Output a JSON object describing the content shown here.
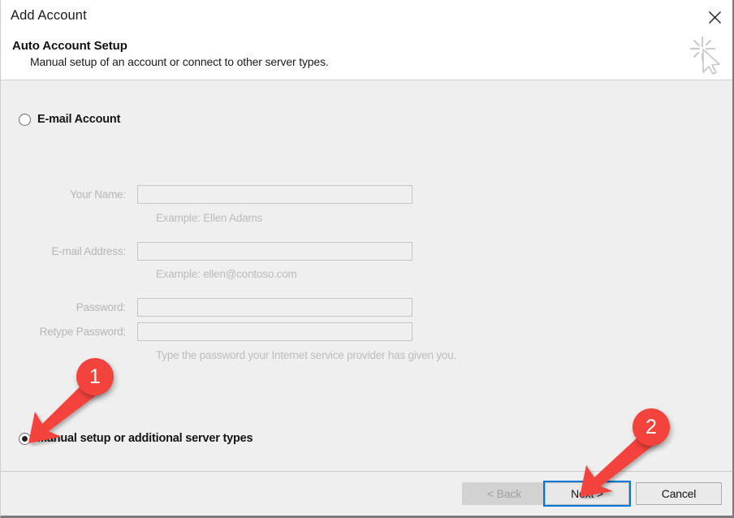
{
  "window": {
    "title": "Add Account",
    "close_icon": "close-icon",
    "header_icon": "cursor-sparkle-icon"
  },
  "header": {
    "heading": "Auto Account Setup",
    "subtext": "Manual setup of an account or connect to other server types."
  },
  "options": {
    "email_account": {
      "label": "E-mail Account",
      "selected": false
    },
    "manual_setup": {
      "label": "Manual setup or additional server types",
      "selected": true
    }
  },
  "form": {
    "enabled": false,
    "fields": [
      {
        "name": "your-name",
        "label": "Your Name:",
        "value": "",
        "placeholder": "",
        "hint": "Example: Ellen Adams"
      },
      {
        "name": "email-address",
        "label": "E-mail Address:",
        "value": "",
        "placeholder": "",
        "hint": "Example: ellen@contoso.com"
      },
      {
        "name": "password",
        "label": "Password:",
        "value": "",
        "placeholder": "",
        "hint": ""
      },
      {
        "name": "retype-password",
        "label": "Retype Password:",
        "value": "",
        "placeholder": "",
        "hint": ""
      }
    ],
    "password_hint": "Type the password your Internet service provider has given you."
  },
  "footer": {
    "back_label": "< Back",
    "back_enabled": false,
    "next_label": "Next >",
    "next_focused": true,
    "cancel_label": "Cancel"
  },
  "annotations": [
    {
      "id": "1",
      "label": "1",
      "points_to": "manual-setup-radio"
    },
    {
      "id": "2",
      "label": "2",
      "points_to": "next-button"
    }
  ],
  "colors": {
    "annotation_red": "#F4433C",
    "focus_blue": "#0078D7",
    "dialog_background": "#EFEFEF",
    "header_background": "#FFFFFF"
  }
}
